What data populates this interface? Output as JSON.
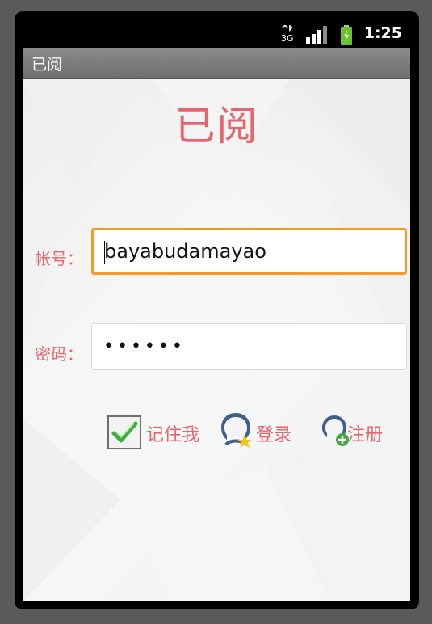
{
  "status_bar": {
    "network_label": "3G",
    "time": "1:25",
    "icons": [
      "3g-icon",
      "signal-icon",
      "battery-icon"
    ]
  },
  "titlebar": {
    "title": "已阅"
  },
  "login": {
    "heading": "已阅",
    "account_label": "帐号：",
    "account_value": "bayabudamayao",
    "password_label": "密码：",
    "password_mask": "••••••",
    "remember_label": "记住我",
    "remember_checked": true,
    "login_label": "登录",
    "register_label": "注册"
  },
  "colors": {
    "accent": "#e8646c",
    "focus_border": "#f39b26",
    "titlebar": "#7a7a7a",
    "check_green": "#3fae3f",
    "avatar_blue": "#3f5f8c"
  }
}
